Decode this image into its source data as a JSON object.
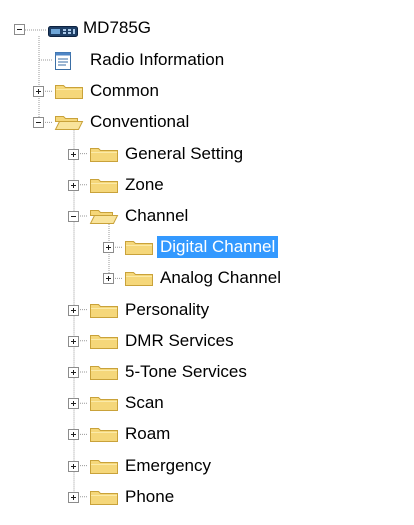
{
  "tree": {
    "root": {
      "label": "MD785G",
      "icon": "radio-device-icon",
      "expanded": true
    },
    "nodes": [
      {
        "label": "Radio Information",
        "depth": 1,
        "type": "document",
        "icon": "document-icon"
      },
      {
        "label": "Common",
        "depth": 1,
        "type": "folder",
        "expanded": false,
        "icon": "folder-icon"
      },
      {
        "label": "Conventional",
        "depth": 1,
        "type": "folder",
        "expanded": true,
        "icon": "folder-open-icon"
      },
      {
        "label": "General Setting",
        "depth": 2,
        "type": "folder",
        "expanded": false,
        "icon": "folder-icon"
      },
      {
        "label": "Zone",
        "depth": 2,
        "type": "folder",
        "expanded": false,
        "icon": "folder-icon"
      },
      {
        "label": "Channel",
        "depth": 2,
        "type": "folder",
        "expanded": true,
        "icon": "folder-open-icon"
      },
      {
        "label": "Digital Channel",
        "depth": 3,
        "type": "folder",
        "expanded": false,
        "selected": true,
        "icon": "folder-icon"
      },
      {
        "label": "Analog Channel",
        "depth": 3,
        "type": "folder",
        "expanded": false,
        "icon": "folder-icon"
      },
      {
        "label": "Personality",
        "depth": 2,
        "type": "folder",
        "expanded": false,
        "icon": "folder-icon"
      },
      {
        "label": "DMR Services",
        "depth": 2,
        "type": "folder",
        "expanded": false,
        "icon": "folder-icon"
      },
      {
        "label": "5-Tone Services",
        "depth": 2,
        "type": "folder",
        "expanded": false,
        "icon": "folder-icon"
      },
      {
        "label": "Scan",
        "depth": 2,
        "type": "folder",
        "expanded": false,
        "icon": "folder-icon"
      },
      {
        "label": "Roam",
        "depth": 2,
        "type": "folder",
        "expanded": false,
        "icon": "folder-icon"
      },
      {
        "label": "Emergency",
        "depth": 2,
        "type": "folder",
        "expanded": false,
        "icon": "folder-icon"
      },
      {
        "label": "Phone",
        "depth": 2,
        "type": "folder",
        "expanded": false,
        "icon": "folder-icon"
      }
    ]
  },
  "colors": {
    "selection": "#3399ff",
    "folder_fill": "#f5d77a",
    "folder_stroke": "#c9a23a",
    "tree_line": "#9a9a9a"
  }
}
